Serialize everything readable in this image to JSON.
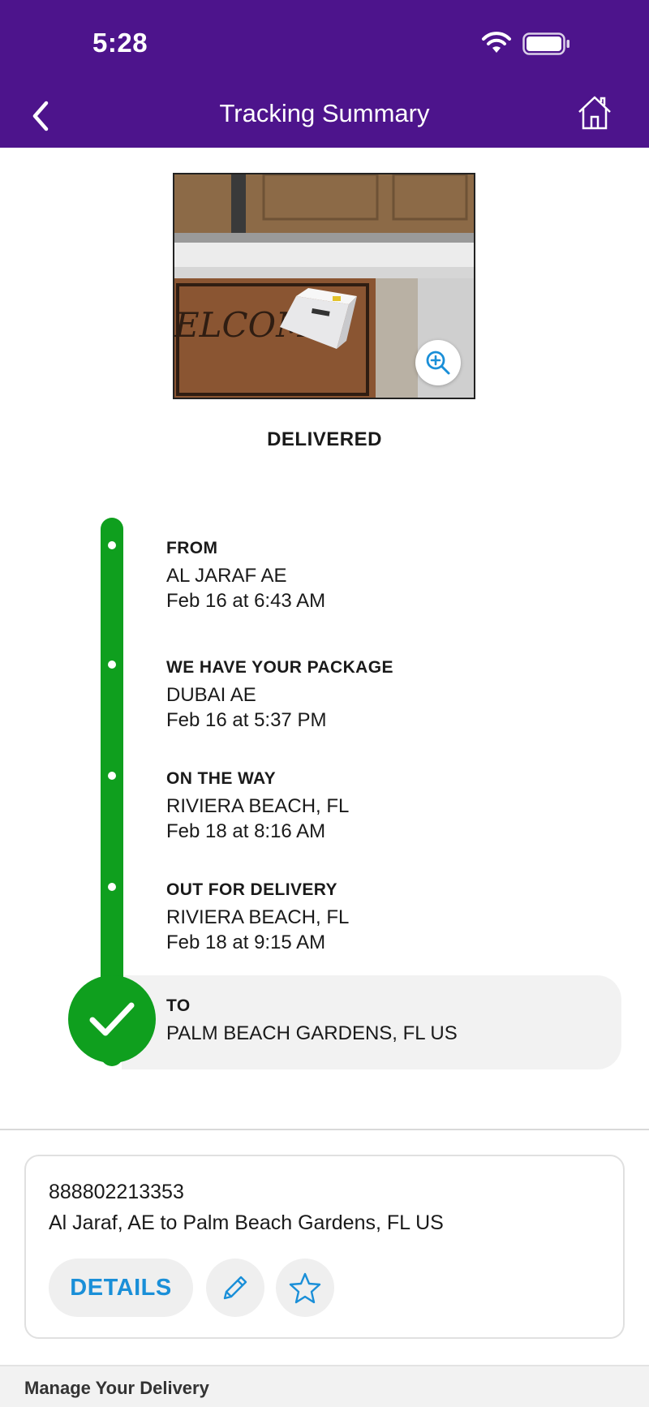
{
  "status_bar": {
    "time": "5:28"
  },
  "header": {
    "title": "Tracking Summary",
    "back_icon": "chevron-left-icon",
    "home_icon": "home-icon"
  },
  "photo": {
    "zoom_icon": "zoom-in-icon"
  },
  "status": "DELIVERED",
  "timeline": [
    {
      "title": "FROM",
      "lines": [
        "AL JARAF AE",
        "Feb 16 at 6:43 AM"
      ]
    },
    {
      "title": "WE HAVE YOUR PACKAGE",
      "lines": [
        "DUBAI AE",
        "Feb 16 at 5:37 PM"
      ]
    },
    {
      "title": "ON THE WAY",
      "lines": [
        "RIVIERA BEACH, FL",
        "Feb 18 at 8:16 AM"
      ]
    },
    {
      "title": "OUT FOR DELIVERY",
      "lines": [
        "RIVIERA BEACH, FL",
        "Feb 18 at 9:15 AM"
      ]
    },
    {
      "title": "TO",
      "lines": [
        "PALM BEACH GARDENS, FL  US"
      ]
    }
  ],
  "card": {
    "tracking_number": "888802213353",
    "route": "Al Jaraf, AE to Palm Beach Gardens, FL US",
    "details_label": "DETAILS",
    "edit_icon": "pencil-icon",
    "favorite_icon": "star-icon"
  },
  "footer": {
    "label": "Manage Your Delivery"
  },
  "colors": {
    "brand_purple": "#4d148c",
    "delivered_green": "#0f9f1e",
    "link_blue": "#1a8fd8"
  }
}
